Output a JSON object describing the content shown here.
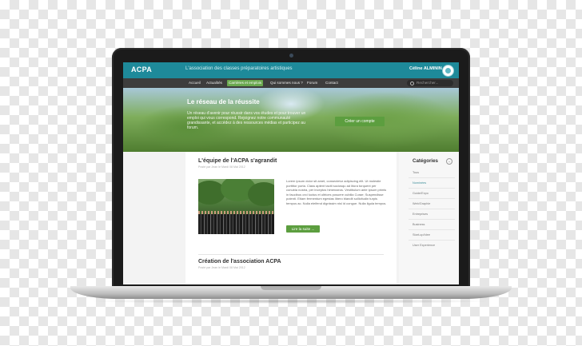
{
  "site": {
    "logo": "ACPA",
    "tagline": "L'association des classes préparatoires artistiques",
    "user_name": "Céline ALMININ"
  },
  "nav": {
    "items": [
      {
        "label": "Accueil",
        "active": false
      },
      {
        "label": "Actualités",
        "active": false
      },
      {
        "label": "Carrières et emplois",
        "active": true
      },
      {
        "label": "Qui sommes nous ?",
        "active": false
      },
      {
        "label": "Forum",
        "active": false
      },
      {
        "label": "Contact",
        "active": false
      }
    ],
    "search_placeholder": "Rechercher..."
  },
  "hero": {
    "title": "Le réseau de la réussite",
    "text": "Un réseau d'avenir pour réussir dans vos études et pour trouver un emploi qui vous correspond. Rejoignez notre communauté grandissante, et accédez à des ressources médias et participez au forum.",
    "button": "Créer un compte"
  },
  "posts": [
    {
      "title": "L'équipe de l'ACPA s'agrandit",
      "meta": "Posté par Jean le Mardi 08 Mai 2012",
      "excerpt": "Lorem ipsum dolor sit amet, consectetur adipiscing elit. Ut molestie porttitor porta. Class aptent taciti sociosqu ad litora torquent per conubia nostra, per inceptos himenaeos. Vestibulum ante ipsum primis in faucibus orci luctus et ultrices posuere cubilia Curae; Suspendisse potenti. Etiam fermentum egestas libero blandit sollicitudin turpis tempus ac. Nulla eleifend dignissim nisl id congue. Nulla ligula tempus.",
      "read_more": "Lire la suite ..."
    },
    {
      "title": "Création de l'association ACPA",
      "meta": "Posté par Jean le Mardi 08 Mai 2012"
    }
  ],
  "sidebar": {
    "heading": "Catégories",
    "items": [
      {
        "label": "Tous",
        "active": false
      },
      {
        "label": "Nominées",
        "active": true
      },
      {
        "label": "Guide/Expo",
        "active": false
      },
      {
        "label": "Web/Graphie",
        "active": false
      },
      {
        "label": "Entreprises",
        "active": false
      },
      {
        "label": "Business",
        "active": false
      },
      {
        "label": "Start-up/Idee",
        "active": false
      },
      {
        "label": "User Experience",
        "active": false
      }
    ]
  },
  "colors": {
    "header": "#1e8a9a",
    "nav": "#3d3d3d",
    "accent_green": "#5c9e3f"
  }
}
